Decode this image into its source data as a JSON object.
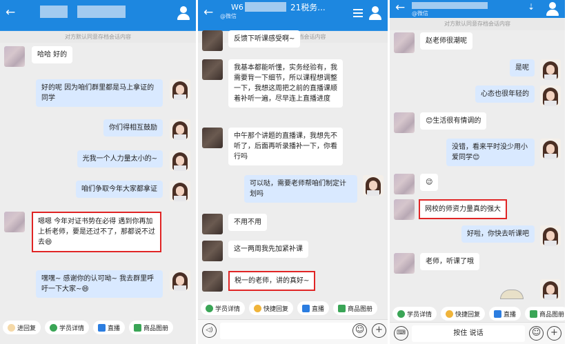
{
  "notice": "对方默认同意存档会话内容",
  "panel1": {
    "messages": [
      {
        "side": "left",
        "text": "哈哈 好的"
      },
      {
        "side": "right",
        "text": "好的呢 因为咱们群里都是马上拿证的同学"
      },
      {
        "side": "right",
        "text": "你们得相互鼓励"
      },
      {
        "side": "right",
        "text": "光我一个人力量太小的~"
      },
      {
        "side": "right",
        "text": "咱们争取今年大家都拿证"
      },
      {
        "side": "left",
        "text": "嗯嗯  今年对证书势在必得   遇到你再加上析老师，要是还过不了，那都说不过去😄",
        "highlight": true
      },
      {
        "side": "right",
        "text": "嘿嘿~ 感谢你的认可呦~ 我去群里呼吁一下大家~😄"
      }
    ],
    "toolbar": [
      "进回复",
      "学员详情",
      "直播",
      "商品图册"
    ]
  },
  "panel2": {
    "title_left": "W6",
    "title_right": "21税务...",
    "subtitle": "@微信",
    "messages": [
      {
        "side": "left",
        "text": "反馈下听课感受啊~"
      },
      {
        "side": "left",
        "text": "我基本都能听懂，实务经验有，我需要背一下细节，所以课程想调整一下，我想这周把之前的直播课顺着补听一遍，尽早连上直播进度"
      },
      {
        "side": "left",
        "text": "中午那个讲题的直播课，我想先不听了，后面再听录播补一下，你看行吗"
      },
      {
        "side": "right",
        "text": "可以哒，需要老师帮咱们制定计划吗"
      },
      {
        "side": "left",
        "text": "不用不用"
      },
      {
        "side": "left",
        "text": "这一两周我先加紧补课"
      },
      {
        "side": "left",
        "text": "税一的老师，讲的真好~",
        "highlight": true
      }
    ],
    "toolbar": [
      "学员详情",
      "快捷回复",
      "直播",
      "商品图册"
    ]
  },
  "panel3": {
    "subtitle": "@微信",
    "messages": [
      {
        "side": "left",
        "text": "赵老师很潮呢"
      },
      {
        "side": "right",
        "text": "是呢"
      },
      {
        "side": "right",
        "text": "心态也很年轻的"
      },
      {
        "side": "left",
        "text": "😊生活很有情调的"
      },
      {
        "side": "right",
        "text": "没错，看来平时没少用小爱同学😊"
      },
      {
        "side": "left",
        "text": "😉"
      },
      {
        "side": "left",
        "text": "网校的师资力量真的强大",
        "highlight": true
      },
      {
        "side": "right",
        "text": "好啦，你快去听课吧"
      },
      {
        "side": "left",
        "text": "老师，听课了哦"
      }
    ],
    "toolbar": [
      "学员详情",
      "快捷回复",
      "直播",
      "商品图册"
    ],
    "voice_label": "按住 说话"
  }
}
